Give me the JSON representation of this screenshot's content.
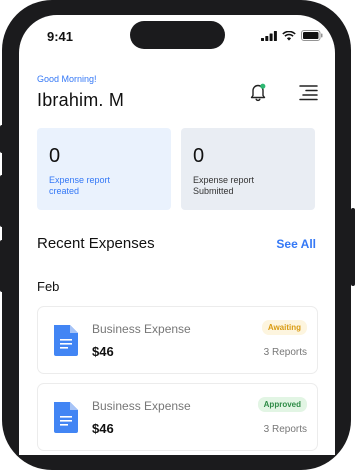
{
  "status_bar": {
    "time": "9:41"
  },
  "header": {
    "greeting": "Good Morning!",
    "user_name": "Ibrahim. M"
  },
  "stats": [
    {
      "value": "0",
      "label": "Expense report\ncreated"
    },
    {
      "value": "0",
      "label": "Expense report\nSubmitted"
    }
  ],
  "recent": {
    "title": "Recent Expenses",
    "see_all": "See All",
    "month": "Feb",
    "items": [
      {
        "title": "Business Expense",
        "amount": "$46",
        "status": "Awaiting",
        "reports": "3 Reports"
      },
      {
        "title": "Business Expense",
        "amount": "$46",
        "status": "Approved",
        "reports": "3 Reports"
      }
    ]
  },
  "colors": {
    "accent": "#3478f6",
    "awaiting": "#d99b12",
    "approved": "#2e8b46",
    "notification_dot": "#2eb872"
  },
  "icons": [
    "signal-icon",
    "wifi-icon",
    "battery-icon",
    "bell-icon",
    "menu-icon",
    "document-icon"
  ]
}
